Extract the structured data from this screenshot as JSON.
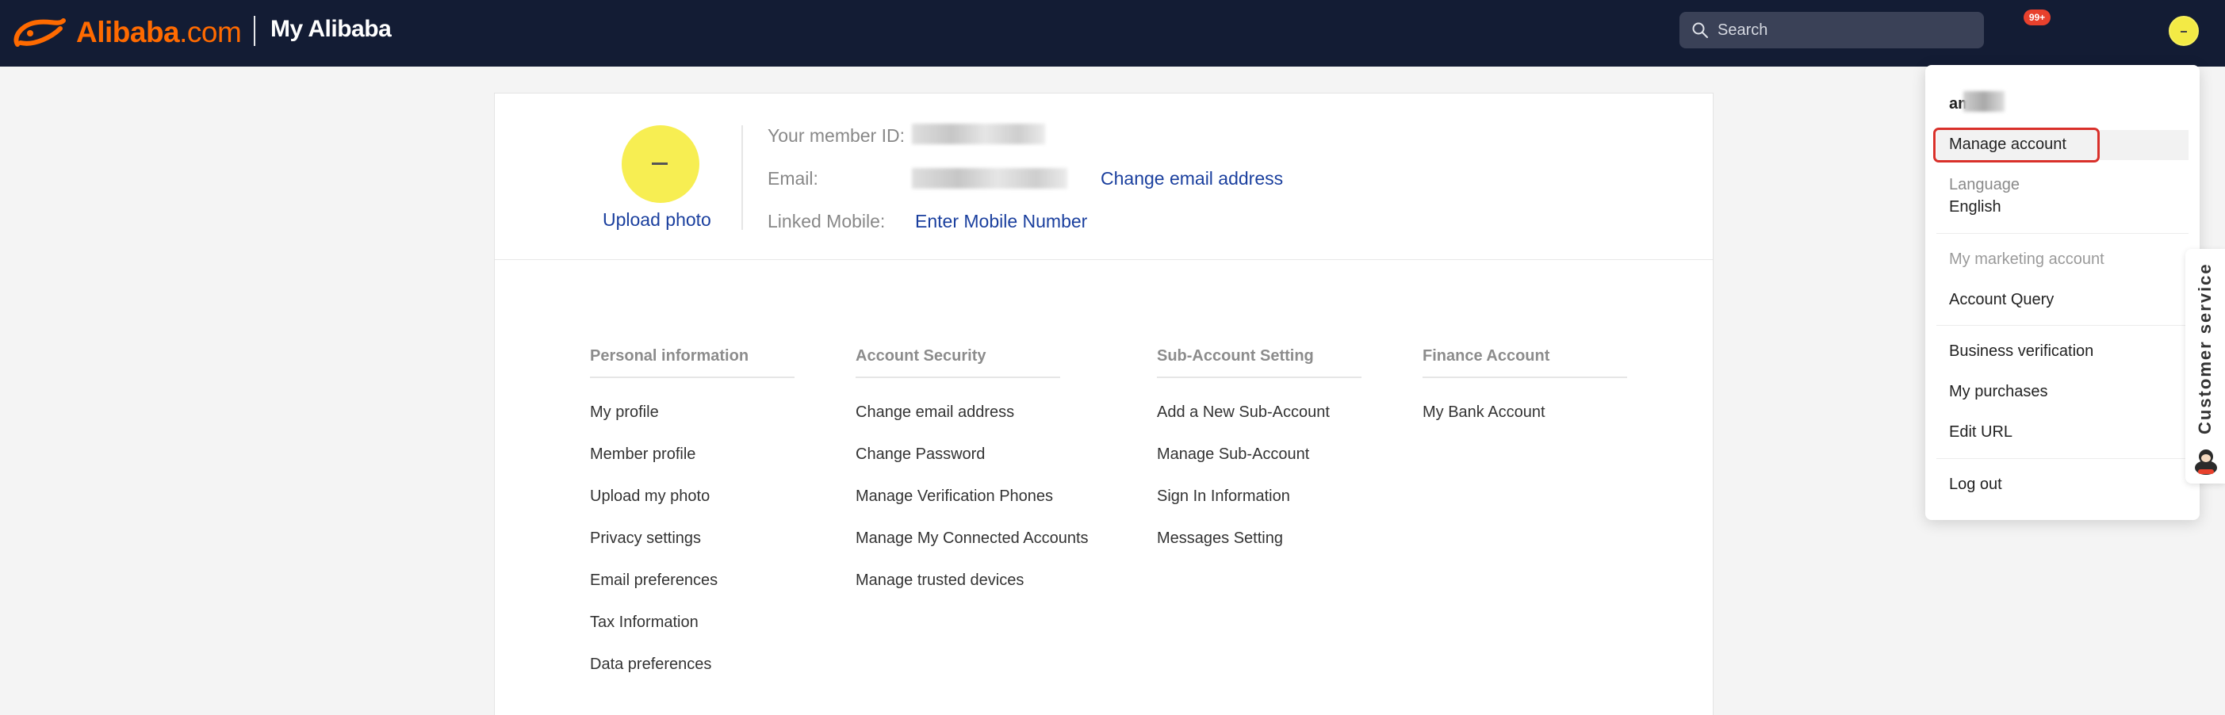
{
  "header": {
    "logo_text": "Alibaba",
    "logo_suffix": ".com",
    "section_title": "My Alibaba",
    "search_placeholder": "Search",
    "notification_count": "99+"
  },
  "profile": {
    "member_id_label": "Your member ID:",
    "email_label": "Email:",
    "change_email_link": "Change email address",
    "linked_mobile_label": "Linked Mobile:",
    "enter_mobile_link": "Enter Mobile Number",
    "upload_photo_link": "Upload photo"
  },
  "columns": [
    {
      "title": "Personal information",
      "items": [
        "My profile",
        "Member profile",
        "Upload my photo",
        "Privacy settings",
        "Email preferences",
        "Tax Information",
        "Data preferences"
      ]
    },
    {
      "title": "Account Security",
      "items": [
        "Change email address",
        "Change Password",
        "Manage Verification Phones",
        "Manage My Connected Accounts",
        "Manage trusted devices"
      ]
    },
    {
      "title": "Sub-Account Setting",
      "items": [
        "Add a New Sub-Account",
        "Manage Sub-Account",
        "Sign In Information",
        "Messages Setting"
      ]
    },
    {
      "title": "Finance Account",
      "items": [
        "My Bank Account"
      ]
    }
  ],
  "dropdown": {
    "username": "aml",
    "manage_account": "Manage account",
    "language_label": "Language",
    "language_value": "English",
    "marketing_label": "My marketing account",
    "account_query": "Account Query",
    "business_verification": "Business verification",
    "my_purchases": "My purchases",
    "edit_url": "Edit URL",
    "log_out": "Log out"
  },
  "customer_service": {
    "label": "Customer service"
  },
  "colors": {
    "header_bg": "#131c34",
    "brand_orange": "#ff6a00",
    "link_blue": "#1a3f9e",
    "highlight_red": "#d9302a",
    "avatar_yellow": "#f3ea45"
  }
}
